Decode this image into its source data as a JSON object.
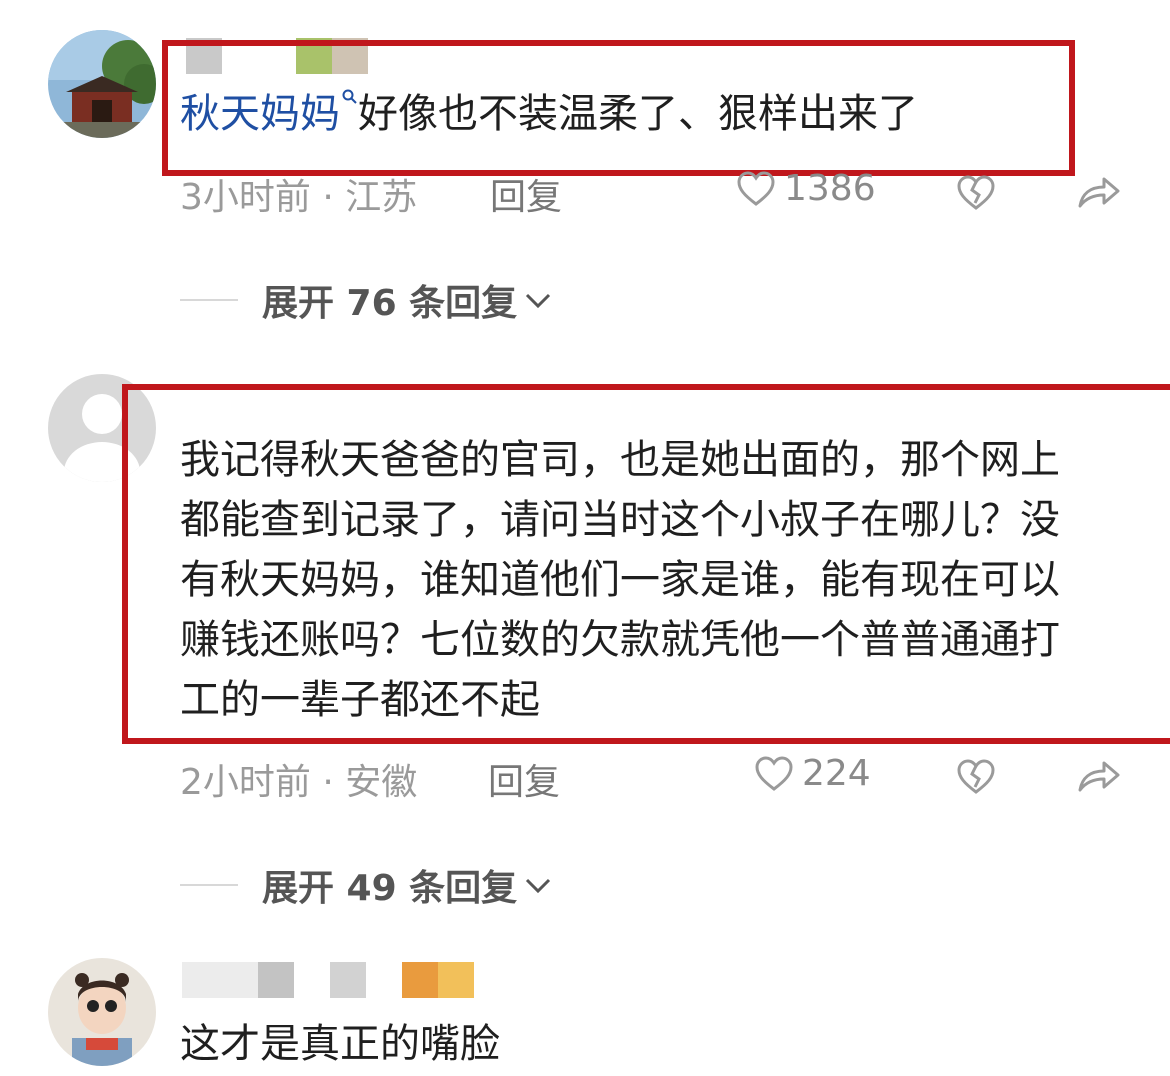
{
  "comments": [
    {
      "mention": "秋天妈妈",
      "text": "好像也不装温柔了、狠样出来了",
      "time_location": "3小时前 · 江苏",
      "reply_label": "回复",
      "likes": "1386"
    },
    {
      "text": "我记得秋天爸爸的官司，也是她出面的，那个网上都能查到记录了，请问当时这个小叔子在哪儿？没有秋天妈妈，谁知道他们一家是谁，能有现在可以赚钱还账吗？七位数的欠款就凭他一个普普通通打工的一辈子都还不起",
      "time_location": "2小时前 · 安徽",
      "reply_label": "回复",
      "likes": "224"
    },
    {
      "text": "这才是真正的嘴脸"
    }
  ],
  "expand": [
    {
      "label": "展开 76 条回复"
    },
    {
      "label": "展开 49 条回复"
    }
  ],
  "colors": {
    "highlight_box": "#c0171c",
    "mention": "#1f4fa3"
  }
}
